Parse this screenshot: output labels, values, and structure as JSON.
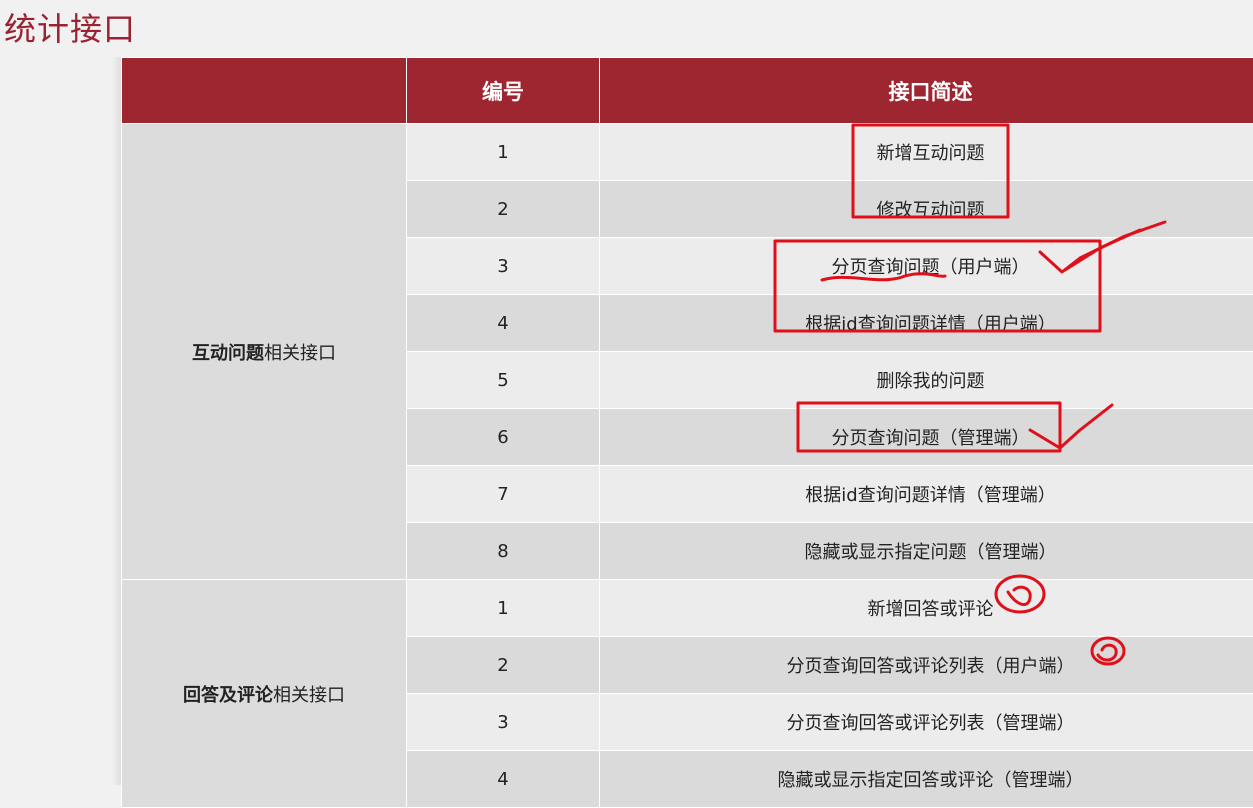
{
  "title": "统计接口",
  "table": {
    "headers": [
      "",
      "编号",
      "接口简述"
    ],
    "groups": [
      {
        "label_bold": "互动问题",
        "label_rest": "相关接口",
        "rows": [
          {
            "num": "1",
            "desc": "新增互动问题"
          },
          {
            "num": "2",
            "desc": "修改互动问题"
          },
          {
            "num": "3",
            "desc": "分页查询问题（用户端）"
          },
          {
            "num": "4",
            "desc": "根据id查询问题详情（用户端）"
          },
          {
            "num": "5",
            "desc": "删除我的问题"
          },
          {
            "num": "6",
            "desc": "分页查询问题（管理端）"
          },
          {
            "num": "7",
            "desc": "根据id查询问题详情（管理端）"
          },
          {
            "num": "8",
            "desc": "隐藏或显示指定问题（管理端）"
          }
        ]
      },
      {
        "label_bold": "回答及评论",
        "label_rest": "相关接口",
        "rows": [
          {
            "num": "1",
            "desc": "新增回答或评论"
          },
          {
            "num": "2",
            "desc": "分页查询回答或评论列表（用户端）"
          },
          {
            "num": "3",
            "desc": "分页查询回答或评论列表（管理端）"
          },
          {
            "num": "4",
            "desc": "隐藏或显示指定回答或评论（管理端）"
          }
        ]
      }
    ]
  },
  "colors": {
    "header_bg": "#9e2630",
    "title": "#9b2230",
    "annotation_red": "#e0101a"
  }
}
